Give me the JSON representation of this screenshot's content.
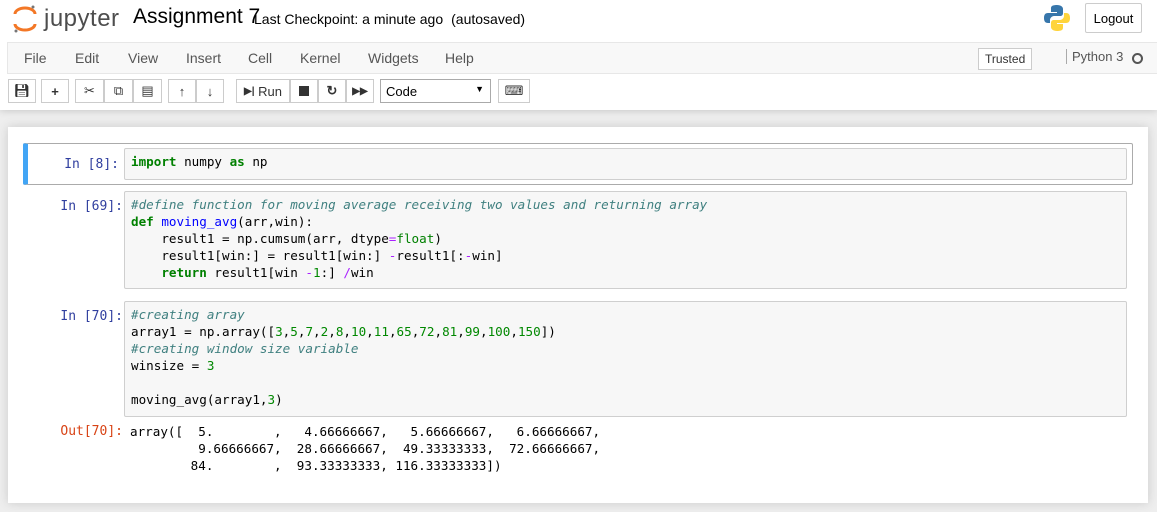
{
  "header": {
    "logo_text": "jupyter",
    "notebook_title": "Assignment 7",
    "checkpoint": "Last Checkpoint: a minute ago",
    "autosaved": "(autosaved)",
    "logout_label": "Logout"
  },
  "menu": [
    "File",
    "Edit",
    "View",
    "Insert",
    "Cell",
    "Kernel",
    "Widgets",
    "Help"
  ],
  "status": {
    "trusted": "Trusted",
    "kernel": "Python 3"
  },
  "toolbar": {
    "run_label": "Run",
    "cell_type": "Code"
  },
  "cells": [
    {
      "prompt": "In [8]:",
      "lines": [
        [
          [
            "kw",
            "import"
          ],
          [
            "",
            "numpy"
          ],
          [
            "kw",
            "as"
          ],
          [
            "",
            "np"
          ]
        ]
      ]
    },
    {
      "prompt": "In [69]:",
      "lines": [
        [
          [
            "cm",
            "#define function for moving average receiving two values and returning array"
          ]
        ],
        [
          [
            "kw",
            "def"
          ],
          [
            "fn",
            "moving_avg"
          ],
          [
            "",
            "(arr,win):"
          ]
        ],
        [
          [
            "",
            "    result1 = np.cumsum(arr, dtype"
          ],
          [
            "op",
            "="
          ],
          [
            "bi",
            "float"
          ],
          [
            "",
            ")"
          ]
        ],
        [
          [
            "",
            "    result1[win:] = result1[win:] "
          ],
          [
            "op",
            "-"
          ],
          [
            "",
            "result1[:"
          ],
          [
            "op",
            "-"
          ],
          [
            "",
            "win]"
          ]
        ],
        [
          [
            "",
            "    "
          ],
          [
            "kw",
            "return"
          ],
          [
            "",
            "result1[win "
          ],
          [
            "op",
            "-"
          ],
          [
            "num",
            "1"
          ],
          [
            "",
            ":] "
          ],
          [
            "op",
            "/"
          ],
          [
            "",
            "win"
          ]
        ]
      ]
    },
    {
      "prompt": "In [70]:",
      "lines": [
        [
          [
            "cm",
            "#creating array"
          ]
        ],
        [
          [
            "",
            "array1 = np.array(["
          ],
          [
            "num",
            "3"
          ],
          [
            "",
            ","
          ],
          [
            "num",
            "5"
          ],
          [
            "",
            ","
          ],
          [
            "num",
            "7"
          ],
          [
            "",
            ","
          ],
          [
            "num",
            "2"
          ],
          [
            "",
            ","
          ],
          [
            "num",
            "8"
          ],
          [
            "",
            ","
          ],
          [
            "num",
            "10"
          ],
          [
            "",
            ","
          ],
          [
            "num",
            "11"
          ],
          [
            "",
            ","
          ],
          [
            "num",
            "65"
          ],
          [
            "",
            ","
          ],
          [
            "num",
            "72"
          ],
          [
            "",
            ","
          ],
          [
            "num",
            "81"
          ],
          [
            "",
            ","
          ],
          [
            "num",
            "99"
          ],
          [
            "",
            ","
          ],
          [
            "num",
            "100"
          ],
          [
            "",
            ","
          ],
          [
            "num",
            "150"
          ],
          [
            "",
            "])"
          ]
        ],
        [
          [
            "cm",
            "#creating window size variable"
          ]
        ],
        [
          [
            "",
            "winsize = "
          ],
          [
            "num",
            "3"
          ]
        ],
        [
          [
            "",
            ""
          ]
        ],
        [
          [
            "",
            "moving_avg(array1,"
          ],
          [
            "num",
            "3"
          ],
          [
            "",
            ")"
          ]
        ]
      ],
      "out_prompt": "Out[70]:",
      "output": "array([  5.        ,   4.66666667,   5.66666667,   6.66666667,\n         9.66666667,  28.66666667,  49.33333333,  72.66666667,\n        84.        ,  93.33333333, 116.33333333])"
    }
  ]
}
